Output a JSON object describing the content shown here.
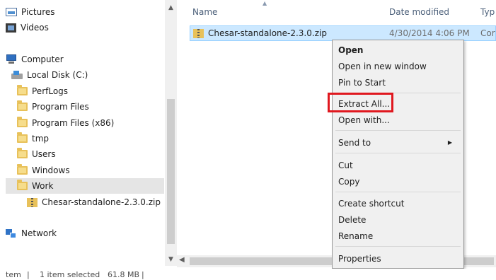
{
  "nav": {
    "items": [
      {
        "label": "Pictures",
        "icon": "pictures-icon"
      },
      {
        "label": "Videos",
        "icon": "videos-icon"
      },
      {
        "label": "Computer",
        "icon": "computer-icon"
      },
      {
        "label": "Local Disk (C:)",
        "icon": "local-disk-icon"
      },
      {
        "label": "PerfLogs",
        "icon": "folder-icon"
      },
      {
        "label": "Program Files",
        "icon": "folder-icon"
      },
      {
        "label": "Program Files (x86)",
        "icon": "folder-icon"
      },
      {
        "label": "tmp",
        "icon": "folder-icon"
      },
      {
        "label": "Users",
        "icon": "folder-icon"
      },
      {
        "label": "Windows",
        "icon": "folder-icon"
      },
      {
        "label": "Work",
        "icon": "folder-icon",
        "selected": true
      },
      {
        "label": "Chesar-standalone-2.3.0.zip",
        "icon": "zip-archive-icon"
      },
      {
        "label": "Network",
        "icon": "network-icon"
      }
    ]
  },
  "columns": {
    "name": "Name",
    "date_modified": "Date modified",
    "type": "Typ"
  },
  "file_list": {
    "rows": [
      {
        "name": "Chesar-standalone-2.3.0.zip",
        "date_modified": "4/30/2014 4:06 PM",
        "type": "Cor",
        "selected": true
      }
    ]
  },
  "context_menu": {
    "open": "Open",
    "open_new_window": "Open in new window",
    "pin_to_start": "Pin to Start",
    "extract_all": "Extract All...",
    "open_with": "Open with...",
    "send_to": "Send to",
    "cut": "Cut",
    "copy": "Copy",
    "create_shortcut": "Create shortcut",
    "delete": "Delete",
    "rename": "Rename",
    "properties": "Properties",
    "highlight_color": "#e0181f"
  },
  "status_bar": {
    "items_text": "tem",
    "selected_text": "1 item selected",
    "size_text": "61.8 MB"
  },
  "colors": {
    "selection": "#cce8ff",
    "selection_border": "#99d1ff",
    "menu_bg": "#f0f0f0"
  }
}
